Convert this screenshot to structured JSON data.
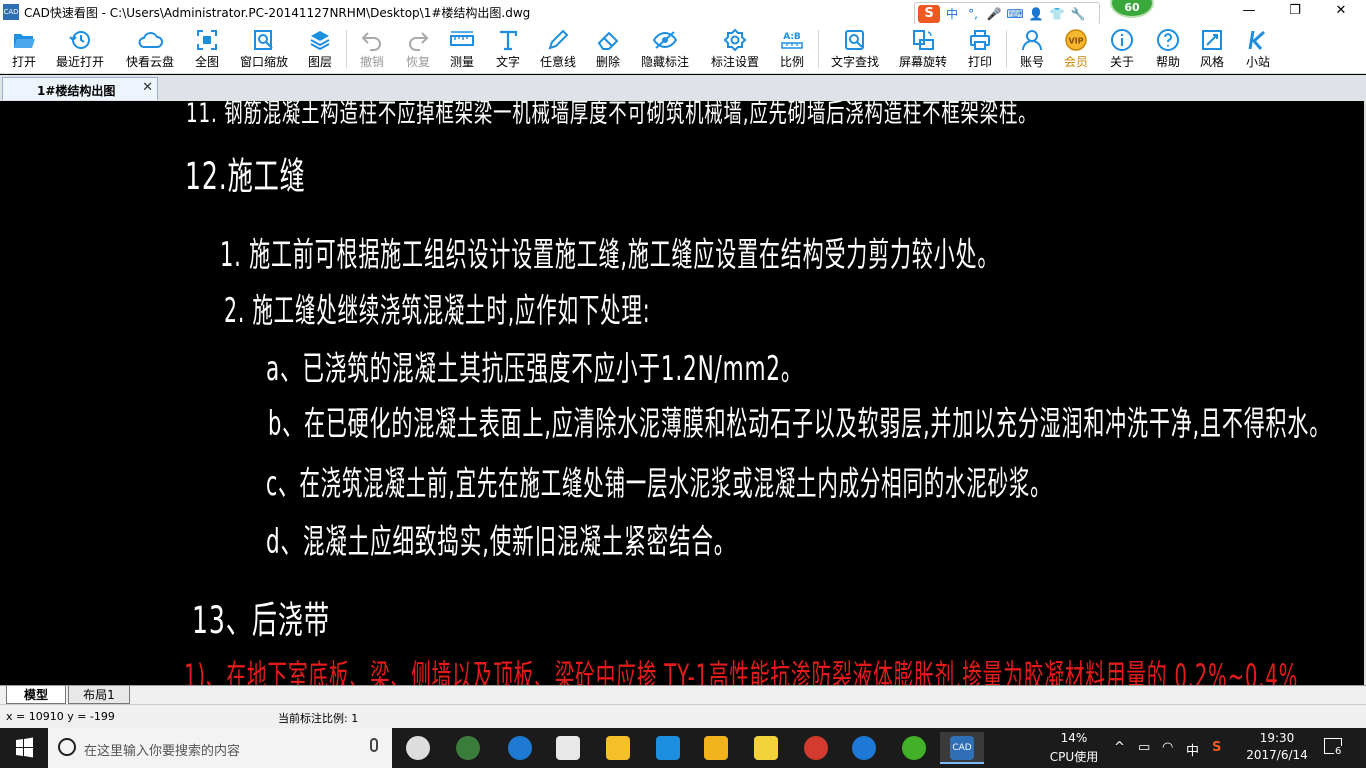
{
  "window": {
    "title": "CAD快速看图 - C:\\Users\\Administrator.PC-20141127NRHM\\Desktop\\1#楼结构出图.dwg",
    "app_icon_text": "CAD",
    "badge": "60"
  },
  "ime": {
    "logo": "S",
    "items": [
      "中",
      "°,",
      "🎤",
      "⌨",
      "👤",
      "👕",
      "🔧"
    ]
  },
  "toolbar": {
    "open": "打开",
    "recent": "最近打开",
    "cloud": "快看云盘",
    "fit_all": "全图",
    "window_zoom": "窗口缩放",
    "layers": "图层",
    "undo": "撤销",
    "redo": "恢复",
    "measure": "测量",
    "text": "文字",
    "freeline": "任意线",
    "erase": "删除",
    "hide_annot": "隐藏标注",
    "annot_settings": "标注设置",
    "scale": "比例",
    "find_text": "文字查找",
    "rotate": "屏幕旋转",
    "print": "打印",
    "account": "账号",
    "vip": "会员",
    "about": "关于",
    "help": "帮助",
    "style": "风格",
    "station": "小站",
    "scale_icon_text": "A:B",
    "vip_icon_text": "VIP"
  },
  "doc_tab": {
    "label": "1#楼结构出图",
    "close": "✕"
  },
  "drawing": {
    "line_top": "11. 钢筋混凝土构造柱不应掉框架梁一机械墙厚度不可砌筑机械墙,应先砌墙后浇构造柱不框架梁柱。",
    "heading_12": "12.施工缝",
    "item_1": "1. 施工前可根据施工组织设计设置施工缝,施工缝应设置在结构受力剪力较小处。",
    "item_2": "2. 施工缝处继续浇筑混凝土时,应作如下处理:",
    "item_a": "a、已浇筑的混凝土其抗压强度不应小于1.2N/mm2。",
    "item_b": "b、在已硬化的混凝土表面上,应清除水泥薄膜和松动石子以及软弱层,并加以充分湿润和冲洗干净,且不得积水。",
    "item_c": "c、在浇筑混凝土前,宜先在施工缝处铺一层水泥浆或混凝土内成分相同的水泥砂浆。",
    "item_d": "d、混凝土应细致捣实,使新旧混凝土紧密结合。",
    "heading_13": "13、后浇带",
    "line_red": "1)、在地下室底板、梁、侧墙以及顶板、梁砼中应掺 TY-1高性能抗渗防裂液体膨胀剂,掺量为胶凝材料用量的 0.2%~0.4%"
  },
  "layout_tabs": {
    "model": "模型",
    "layout1": "布局1"
  },
  "status": {
    "coords": "x = 10910  y = -199",
    "annot_scale": "当前标注比例: 1"
  },
  "taskbar": {
    "search_placeholder": "在这里输入你要搜索的内容",
    "cpu_pct": "14%",
    "cpu_label": "CPU使用",
    "ime_lang": "中",
    "time": "19:30",
    "date": "2017/6/14",
    "notify_count": "6",
    "cad_app_text": "CAD"
  },
  "colors": {
    "canvas_bg": "#000000",
    "cad_text": "#ffffff",
    "cad_red": "#e21b1b",
    "toolbar_icon": "#1e8fe0",
    "taskbar_bg": "#1b1b1b"
  }
}
